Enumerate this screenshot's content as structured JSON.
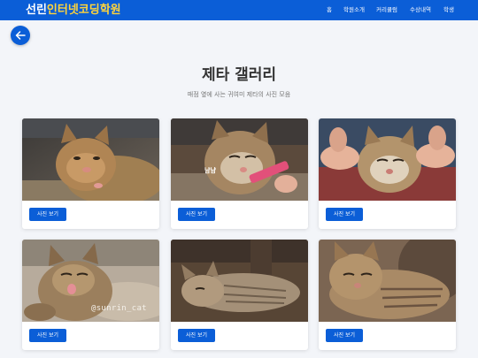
{
  "navbar": {
    "brand_part1": "선린",
    "brand_part2": "인터넷코딩학원",
    "links": [
      "홈",
      "학원소개",
      "커리큘럼",
      "수상내역",
      "학생"
    ]
  },
  "back_button": {
    "icon": "arrow-left-icon"
  },
  "gallery": {
    "title": "제타 갤러리",
    "subtitle": "매점 옆에 사는 귀여미 제타의 사진 모음",
    "cards": [
      {
        "photo_text": "",
        "button_label": "사진 보기"
      },
      {
        "photo_text": "냠냠",
        "button_label": "사진 보기"
      },
      {
        "photo_text": "",
        "button_label": "사진 보기"
      },
      {
        "photo_text": "@sunrin_cat",
        "button_label": "사진 보기"
      },
      {
        "photo_text": "",
        "button_label": "사진 보기"
      },
      {
        "photo_text": "",
        "button_label": "사진 보기"
      }
    ]
  },
  "colors": {
    "primary": "#0b5ed7",
    "brand_accent": "#ffd43b",
    "background": "#f3f5f9"
  }
}
